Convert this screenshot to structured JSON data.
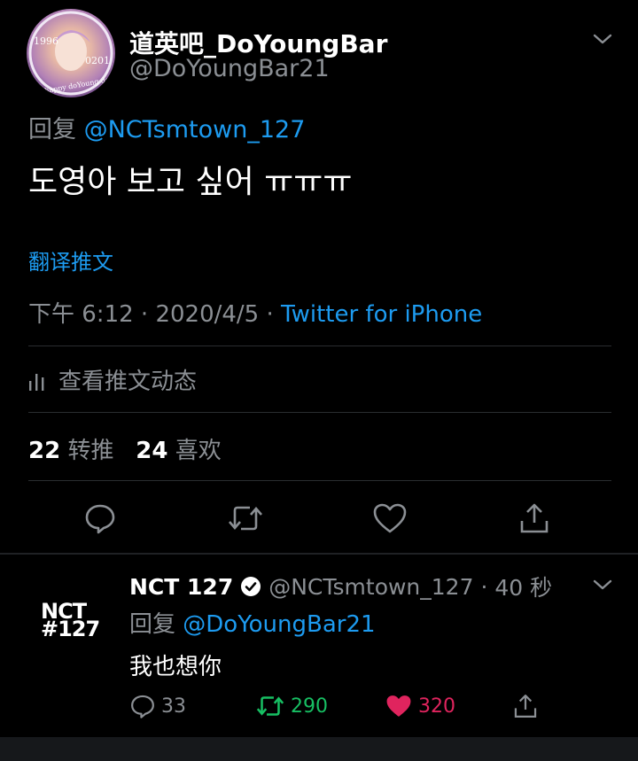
{
  "tweet": {
    "display_name": "道英吧_DoYoungBar",
    "handle": "@DoYoungBar21",
    "avatar_text": {
      "year": "1996",
      "date": "0201",
      "caption": "happy doYoung day"
    },
    "reply_prefix": "回复",
    "reply_target": "@NCTsmtown_127",
    "text": "도영아 보고 싶어 ㅠㅠㅠ",
    "translate_label": "翻译推文",
    "time": "下午 6:12",
    "date": "2020/4/5",
    "source": "Twitter for iPhone",
    "activity_label": "查看推文动态",
    "retweet_count": "22",
    "retweet_label": "转推",
    "like_count": "24",
    "like_label": "喜欢"
  },
  "reply": {
    "logo_line1": "NCT",
    "logo_line2": "#127",
    "display_name": "NCT 127",
    "handle": "@NCTsmtown_127",
    "time_ago": "40 秒",
    "reply_prefix": "回复",
    "reply_target": "@DoYoungBar21",
    "text": "我也想你",
    "comments": "33",
    "retweets": "290",
    "likes": "320"
  },
  "colors": {
    "accent": "#1d9bf0",
    "retweet_green": "#17bf63",
    "like_red": "#e0245e",
    "muted": "#8b8f94"
  }
}
